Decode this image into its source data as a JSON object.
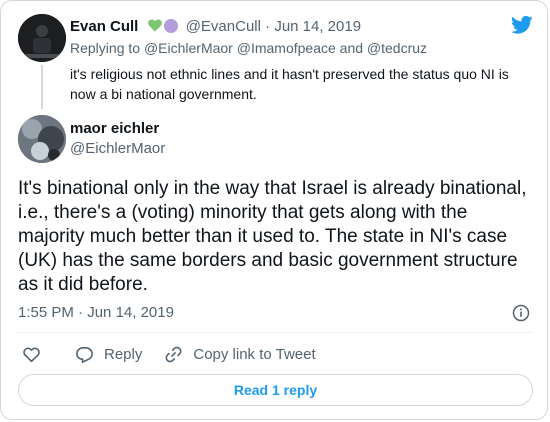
{
  "colors": {
    "accent": "#1d9bf0",
    "muted": "#536471",
    "text": "#0f1419",
    "heart_green": "#7bc66e",
    "circle_purple": "#b39ddb"
  },
  "parent": {
    "name": "Evan Cull",
    "handle": "@EvanCull",
    "sep": "·",
    "date": "Jun 14, 2019",
    "replying_prefix": "Replying to",
    "mention1": "@EichlerMaor",
    "mention2": "@Imamofpeace",
    "and": "and",
    "mention3": "@tedcruz",
    "text": "it's religious not ethnic lines and it hasn't preserved the status quo NI is now a bi national government."
  },
  "tweet": {
    "name": "maor eichler",
    "handle": "@EichlerMaor",
    "text": "It's binational only in the way that Israel is already binational, i.e., there's a (voting) minority that gets along with the majority much better than it used to. The state in NI's case (UK) has the same borders and basic government structure as it did before.",
    "time": "1:55 PM",
    "sep": "·",
    "date": "Jun 14, 2019"
  },
  "actions": {
    "reply_label": "Reply",
    "copy_label": "Copy link to Tweet"
  },
  "read_button": {
    "label": "Read 1 reply"
  },
  "icons": [
    "twitter-bird-icon",
    "green-heart-icon",
    "purple-circle-icon",
    "info-icon",
    "like-heart-icon",
    "reply-icon",
    "link-icon"
  ]
}
